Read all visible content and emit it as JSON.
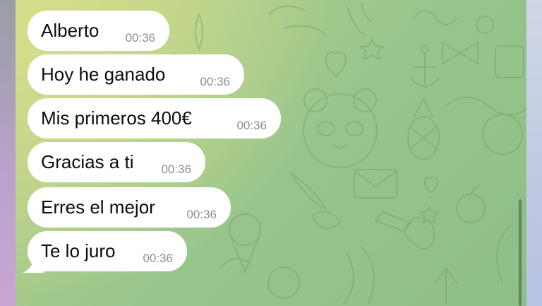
{
  "chat": {
    "messages": [
      {
        "text": "Alberto",
        "time": "00:36"
      },
      {
        "text": "Hoy he ganado",
        "time": "00:36"
      },
      {
        "text": "Mis primeros 400€",
        "time": "00:36"
      },
      {
        "text": "Gracias a ti",
        "time": "00:36"
      },
      {
        "text": "Erres el mejor",
        "time": "00:36"
      },
      {
        "text": "Te lo juro",
        "time": "00:36"
      }
    ]
  },
  "colors": {
    "bubble": "#ffffff",
    "text": "#0c0c0c",
    "timestamp": "#8a8d90",
    "wallpaper_light": "#c8d78c",
    "wallpaper_dark": "#8dbf86"
  }
}
